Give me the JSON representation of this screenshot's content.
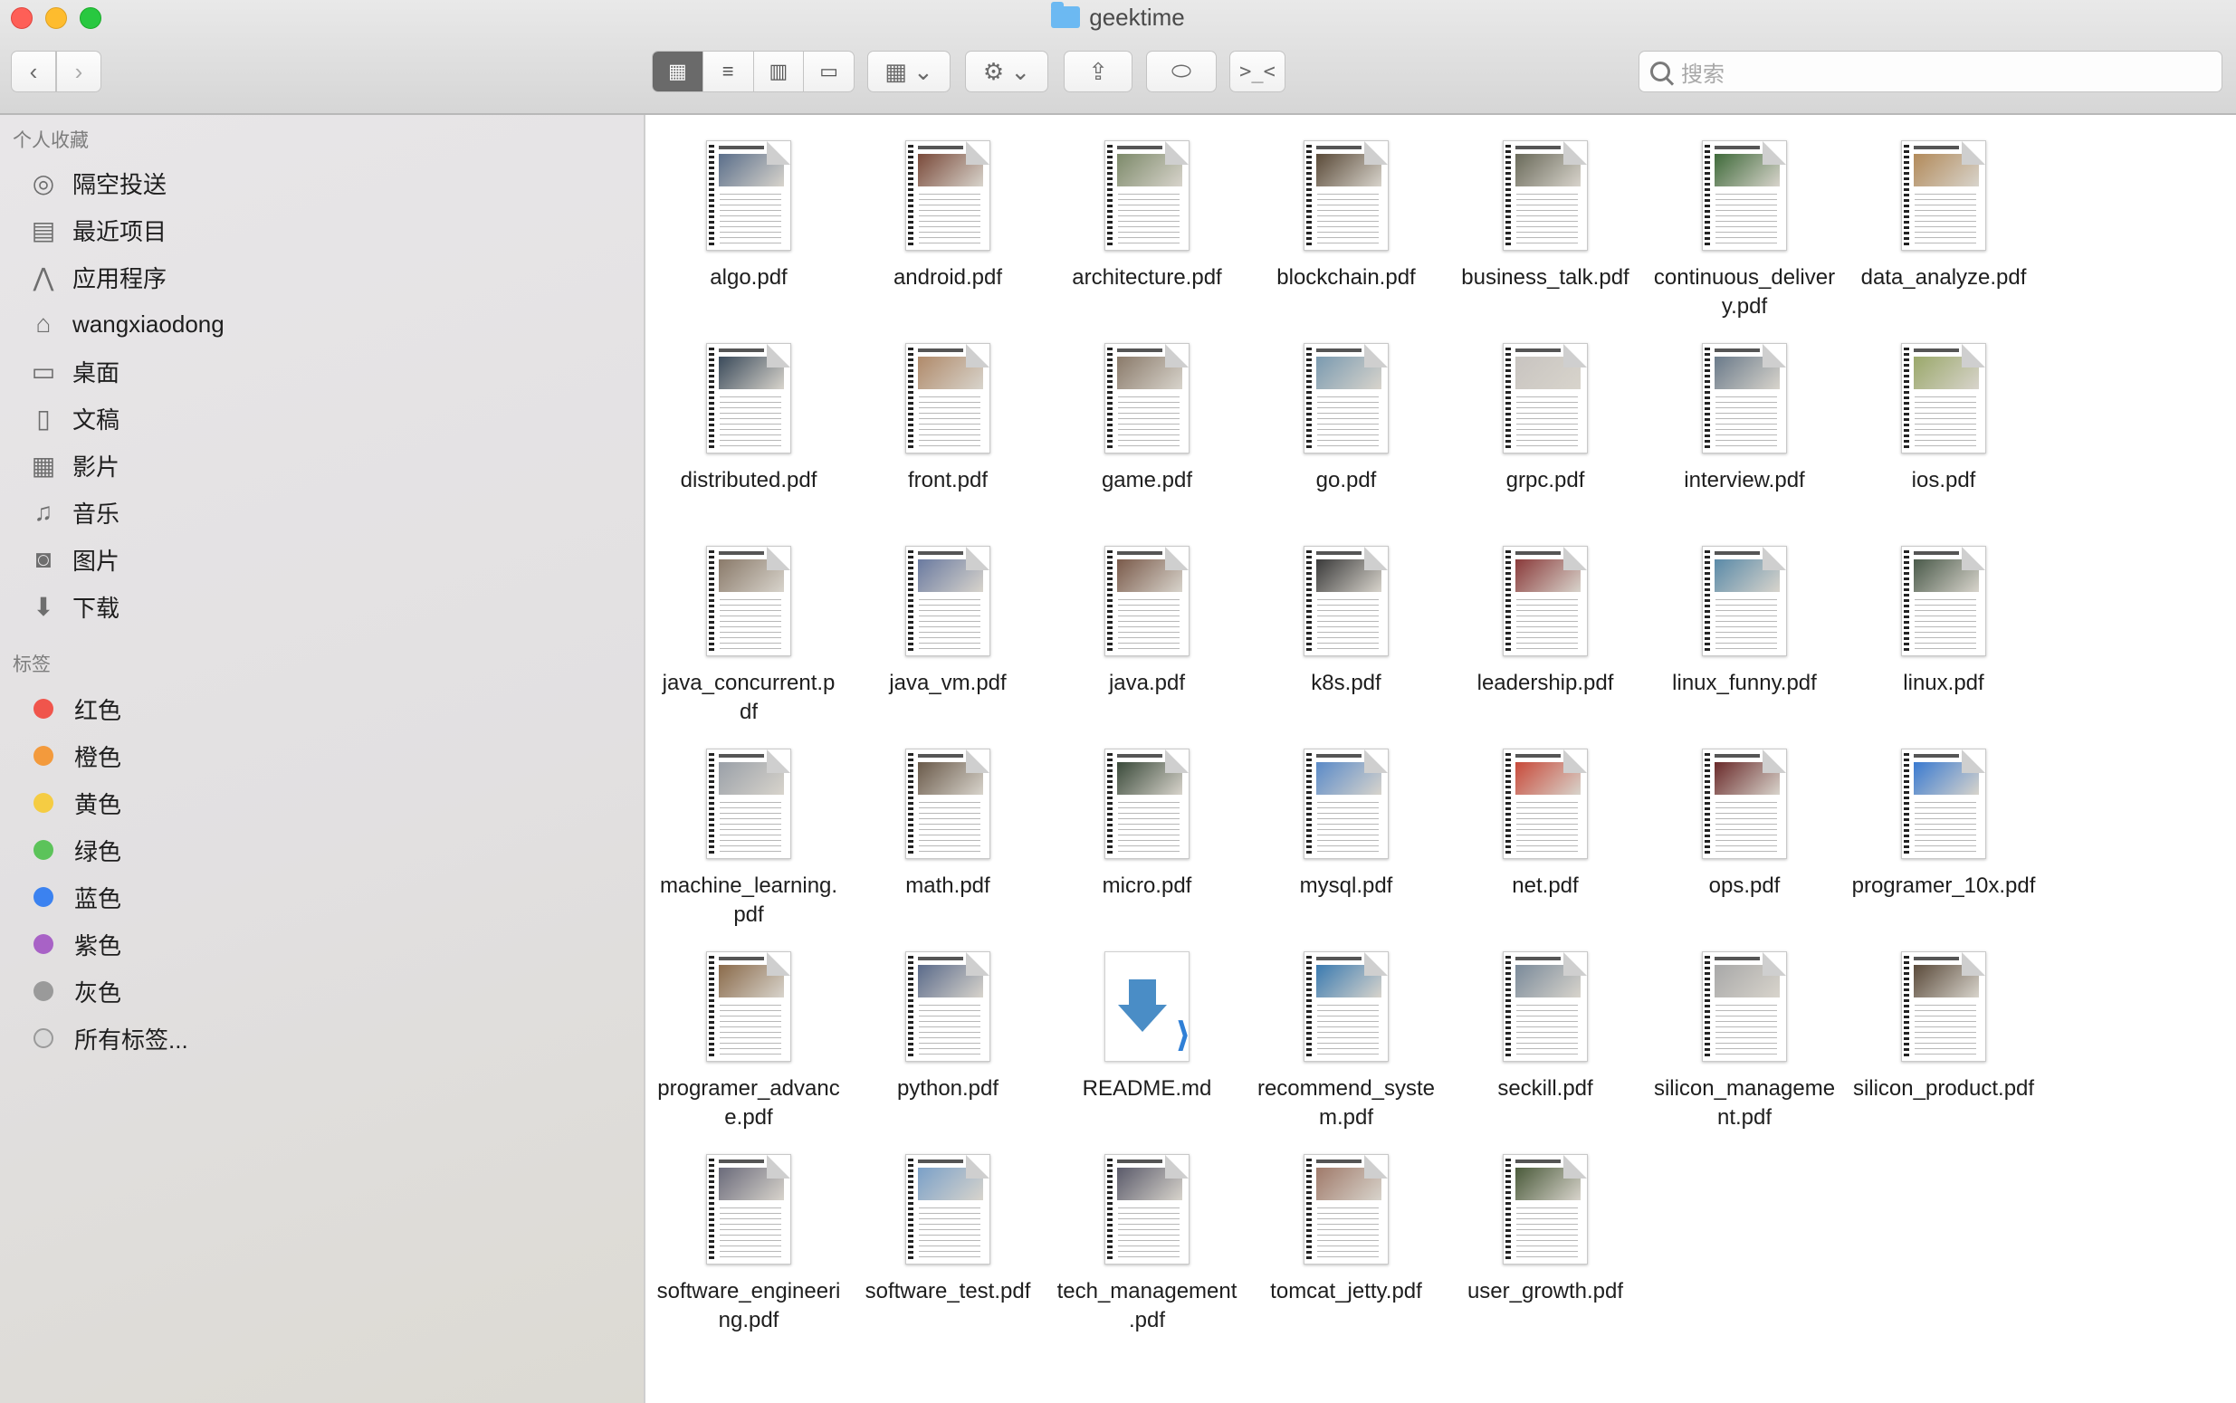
{
  "window": {
    "title": "geektime"
  },
  "toolbar": {
    "back_icon": "‹",
    "forward_icon": "›",
    "view_icons": [
      "▦",
      "≡",
      "▥",
      "▭"
    ],
    "group_label": "▦ ⌄",
    "action_label": "⚙ ⌄",
    "share_label": "⇪",
    "tag_label": "⬭",
    "terminal_label": ">_<",
    "search_placeholder": "搜索"
  },
  "sidebar": {
    "favorites_header": "个人收藏",
    "favorites": [
      {
        "label": "隔空投送",
        "icon": "airdrop-icon",
        "glyph": "◎"
      },
      {
        "label": "最近项目",
        "icon": "recents-icon",
        "glyph": "▤"
      },
      {
        "label": "应用程序",
        "icon": "applications-icon",
        "glyph": "⋀"
      },
      {
        "label": "wangxiaodong",
        "icon": "home-icon",
        "glyph": "⌂"
      },
      {
        "label": "桌面",
        "icon": "desktop-icon",
        "glyph": "▭"
      },
      {
        "label": "文稿",
        "icon": "documents-icon",
        "glyph": "▯"
      },
      {
        "label": "影片",
        "icon": "movies-icon",
        "glyph": "▦"
      },
      {
        "label": "音乐",
        "icon": "music-icon",
        "glyph": "♫"
      },
      {
        "label": "图片",
        "icon": "pictures-icon",
        "glyph": "◙"
      },
      {
        "label": "下载",
        "icon": "downloads-icon",
        "glyph": "⬇"
      }
    ],
    "tags_header": "标签",
    "tags": [
      {
        "label": "红色",
        "color": "#f0554c"
      },
      {
        "label": "橙色",
        "color": "#f39a3c"
      },
      {
        "label": "黄色",
        "color": "#f5cc43"
      },
      {
        "label": "绿色",
        "color": "#5cc35a"
      },
      {
        "label": "蓝色",
        "color": "#3b82f0"
      },
      {
        "label": "紫色",
        "color": "#a862c6"
      },
      {
        "label": "灰色",
        "color": "#9a9a9a"
      },
      {
        "label": "所有标签...",
        "color": "#d8d8d8"
      }
    ]
  },
  "files": [
    {
      "name": "algo.pdf",
      "color": "#5a6e8a"
    },
    {
      "name": "android.pdf",
      "color": "#7a4a3a"
    },
    {
      "name": "architecture.pdf",
      "color": "#7d8a6a"
    },
    {
      "name": "blockchain.pdf",
      "color": "#5a4a38"
    },
    {
      "name": "business_talk.pdf",
      "color": "#6a6a5a"
    },
    {
      "name": "continuous_delivery.pdf",
      "color": "#3f6a3a"
    },
    {
      "name": "data_analyze.pdf",
      "color": "#b28a5a"
    },
    {
      "name": "distributed.pdf",
      "color": "#3a4a5a"
    },
    {
      "name": "front.pdf",
      "color": "#b08a6a"
    },
    {
      "name": "game.pdf",
      "color": "#8a7a6a"
    },
    {
      "name": "go.pdf",
      "color": "#7a9ab0"
    },
    {
      "name": "grpc.pdf",
      "color": "#c8c4c0"
    },
    {
      "name": "interview.pdf",
      "color": "#6a7a8a"
    },
    {
      "name": "ios.pdf",
      "color": "#9aa86a"
    },
    {
      "name": "java_concurrent.pdf",
      "color": "#8a7a6a"
    },
    {
      "name": "java_vm.pdf",
      "color": "#6a7aa0"
    },
    {
      "name": "java.pdf",
      "color": "#7a5a4a"
    },
    {
      "name": "k8s.pdf",
      "color": "#3a3a3a"
    },
    {
      "name": "leadership.pdf",
      "color": "#8a3a3a"
    },
    {
      "name": "linux_funny.pdf",
      "color": "#5a8aa8"
    },
    {
      "name": "linux.pdf",
      "color": "#4a5a4a"
    },
    {
      "name": "machine_learning.pdf",
      "color": "#9aa0a8"
    },
    {
      "name": "math.pdf",
      "color": "#6a5a4a"
    },
    {
      "name": "micro.pdf",
      "color": "#3a4a3a"
    },
    {
      "name": "mysql.pdf",
      "color": "#5a8ac8"
    },
    {
      "name": "net.pdf",
      "color": "#c84a3a"
    },
    {
      "name": "ops.pdf",
      "color": "#6a2a2a"
    },
    {
      "name": "programer_10x.pdf",
      "color": "#3a7ad0"
    },
    {
      "name": "programer_advance.pdf",
      "color": "#8a6a4a"
    },
    {
      "name": "python.pdf",
      "color": "#5a6a8a"
    },
    {
      "name": "README.md",
      "color": "#4a8dc6"
    },
    {
      "name": "recommend_system.pdf",
      "color": "#3a7ab0"
    },
    {
      "name": "seckill.pdf",
      "color": "#7a8a9a"
    },
    {
      "name": "silicon_management.pdf",
      "color": "#a8a8a8"
    },
    {
      "name": "silicon_product.pdf",
      "color": "#5a4a3a"
    },
    {
      "name": "software_engineering.pdf",
      "color": "#6a6a7a"
    },
    {
      "name": "software_test.pdf",
      "color": "#7aa0c8"
    },
    {
      "name": "tech_management.pdf",
      "color": "#5a5a6a"
    },
    {
      "name": "tomcat_jetty.pdf",
      "color": "#a07a6a"
    },
    {
      "name": "user_growth.pdf",
      "color": "#4a5a3a"
    }
  ]
}
